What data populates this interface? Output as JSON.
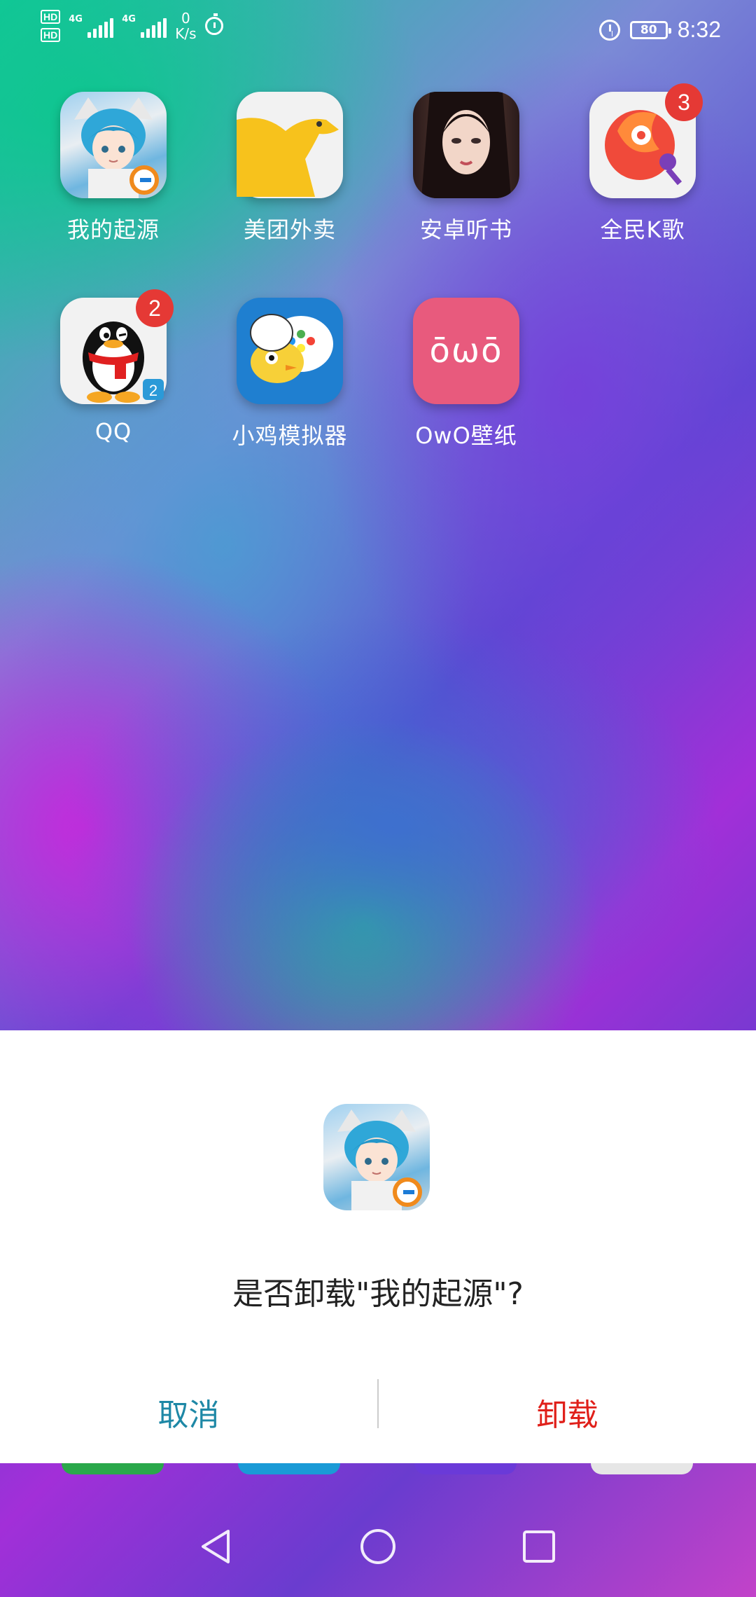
{
  "status_bar": {
    "sim1_label": "HD",
    "sim2_label": "HD",
    "signal1_label": "4G",
    "signal2_label": "4G",
    "net_speed_value": "0",
    "net_speed_unit": "K/s",
    "battery_level": "80",
    "time": "8:32",
    "icons": [
      "timer-icon",
      "alarm-icon",
      "battery-icon"
    ]
  },
  "apps": [
    {
      "label": "我的起源",
      "icon": "anime-girl-icon"
    },
    {
      "label": "美团外卖",
      "icon": "kangaroo-icon"
    },
    {
      "label": "安卓听书",
      "icon": "woman-portrait-icon",
      "badge": ""
    },
    {
      "label": "全民K歌",
      "icon": "karaoke-icon",
      "badge": "3"
    },
    {
      "label": "QQ",
      "icon": "penguin-icon",
      "badge": "2"
    },
    {
      "label": "小鸡模拟器",
      "icon": "chick-gamepad-icon"
    },
    {
      "label": "OwO壁纸",
      "icon": "owo-face-icon",
      "icon_text": "ōωō"
    }
  ],
  "dialog": {
    "message": "是否卸载\"我的起源\"?",
    "cancel_label": "取消",
    "confirm_label": "卸载",
    "colors": {
      "cancel": "#1e88a6",
      "confirm": "#e0201a"
    }
  },
  "navbar": {
    "icons": [
      "back-triangle-icon",
      "home-circle-icon",
      "recents-square-icon"
    ]
  }
}
